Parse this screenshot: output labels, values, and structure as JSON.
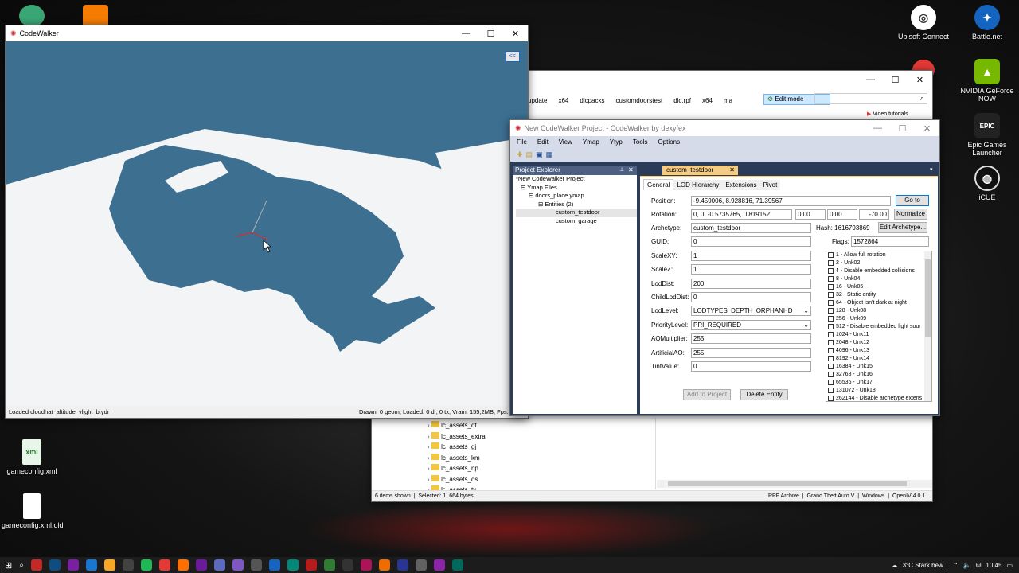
{
  "desktop": {
    "icons_right": [
      {
        "label": "Ubisoft Connect",
        "color": "#2b2b2b"
      },
      {
        "label": "Battle.net",
        "color": "#1565c0"
      },
      {
        "label": "NVIDIA GeForce NOW",
        "color": "#4caf50"
      },
      {
        "label": "Epic Games Launcher",
        "color": "#222222"
      },
      {
        "label": "iCUE",
        "color": "#1a1a1a"
      }
    ],
    "icons_left": [
      {
        "label": "gameconfig.xml"
      },
      {
        "label": "gameconfig.xml.old"
      }
    ]
  },
  "codewalker": {
    "title": "CodeWalker",
    "collapse_label": "<<",
    "status_left": "Loaded cloudhat_altitude_vlight_b.ydr",
    "status_right": "Drawn: 0 geom, Loaded: 0 dr, 0 tx, Vram: 155,2MB, Fps:"
  },
  "explorer": {
    "breadcrumb": [
      "update",
      "x64",
      "dlcpacks",
      "customdoorstest",
      "dlc.rpf",
      "x64",
      "ma"
    ],
    "edit_mode": "Edit mode",
    "video_tutorials": "Video tutorials",
    "tree": [
      "lc_assets_df",
      "lc_assets_extra",
      "lc_assets_gj",
      "lc_assets_km",
      "lc_assets_np",
      "lc_assets_qs",
      "lc_assets_tv"
    ],
    "status_items": "6 items shown",
    "status_selected": "Selected: 1,",
    "status_bytes": "664 bytes",
    "status_right": [
      "RPF Archive",
      "Grand Theft Auto V",
      "Windows",
      "OpenIV 4.0.1"
    ]
  },
  "project": {
    "title": "New CodeWalker Project - CodeWalker by dexyfex",
    "menu": [
      "File",
      "Edit",
      "View",
      "Ymap",
      "Ytyp",
      "Tools",
      "Options"
    ],
    "explorer_title": "Project Explorer",
    "tree": {
      "root": "*New CodeWalker Project",
      "ymap_files": "Ymap Files",
      "ymap": "doors_place.ymap",
      "entities": "Entities (2)",
      "items": [
        "custom_testdoor",
        "custom_garage"
      ]
    },
    "doc_tab": "custom_testdoor",
    "subtabs": [
      "General",
      "LOD Hierarchy",
      "Extensions",
      "Pivot"
    ],
    "fields": {
      "position_label": "Position:",
      "position": "-9.459006, 8.928816, 71.39567",
      "goto": "Go to",
      "rotation_label": "Rotation:",
      "rotation": "0, 0, -0.5735765, 0.819152",
      "rot_x": "0.00",
      "rot_y": "0.00",
      "rot_z": "-70.00",
      "normalize": "Normalize",
      "archetype_label": "Archetype:",
      "archetype": "custom_testdoor",
      "hash": "Hash: 1616793869",
      "edit_archetype": "Edit Archetype...",
      "guid_label": "GUID:",
      "guid": "0",
      "flags_label": "Flags:",
      "flags": "1572864",
      "scalexy_label": "ScaleXY:",
      "scalexy": "1",
      "scalez_label": "ScaleZ:",
      "scalez": "1",
      "loddist_label": "LodDist:",
      "loddist": "200",
      "childloddist_label": "ChildLodDist:",
      "childloddist": "0",
      "lodlevel_label": "LodLevel:",
      "lodlevel": "LODTYPES_DEPTH_ORPHANHD",
      "priority_label": "PriorityLevel:",
      "priority": "PRI_REQUIRED",
      "ao_label": "AOMultiplier:",
      "ao": "255",
      "artao_label": "ArtificialAO:",
      "artao": "255",
      "tint_label": "TintValue:",
      "tint": "0",
      "add_to_project": "Add to Project",
      "delete_entity": "Delete Entity"
    },
    "flag_list": [
      "1 - Allow full rotation",
      "2 - Unk02",
      "4 - Disable embedded collisions",
      "8 - Unk04",
      "16 - Unk05",
      "32 - Static entity",
      "64 - Object isn't dark at night",
      "128 - Unk08",
      "256 - Unk09",
      "512 - Disable embedded light sour",
      "1024 - Unk11",
      "2048 - Unk12",
      "4096 - Unk13",
      "8192 - Unk14",
      "16384 - Unk15",
      "32768 - Unk16",
      "65536 - Unk17",
      "131072 - Unk18",
      "262144 - Disable archetype extens"
    ]
  },
  "taskbar": {
    "weather": "3°C  Stark bew...",
    "time": "10:45"
  }
}
